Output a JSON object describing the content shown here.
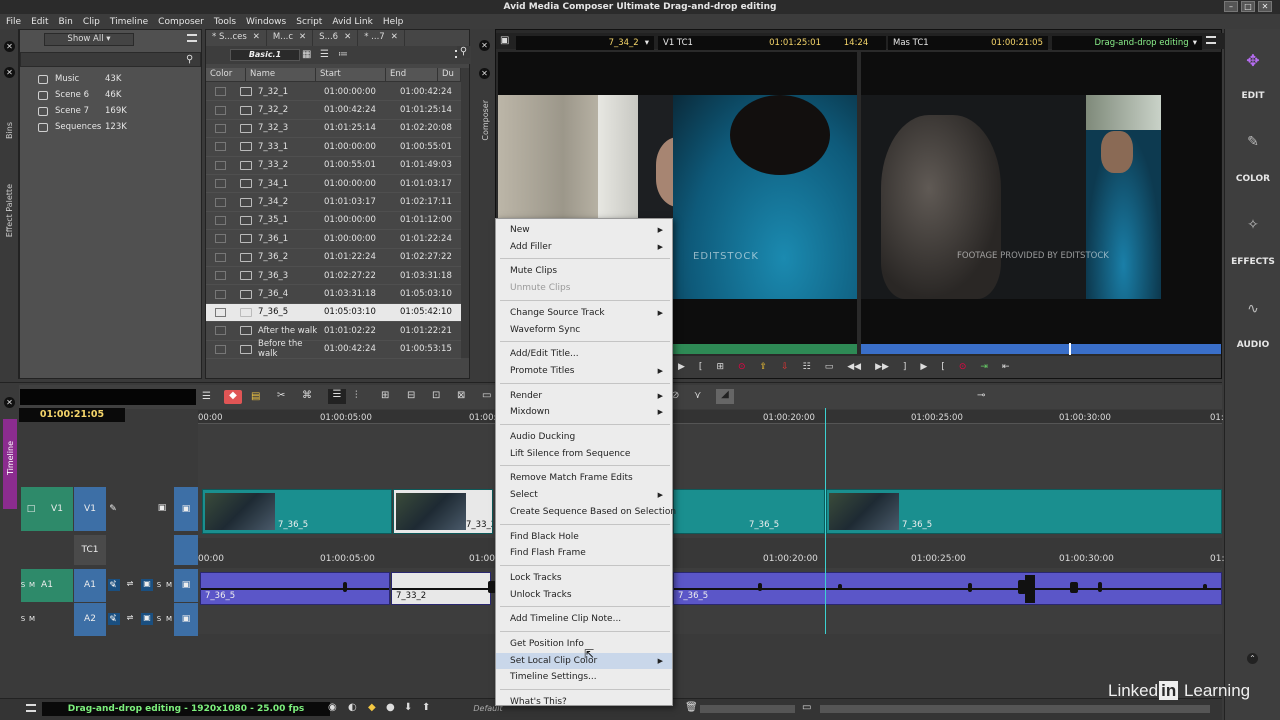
{
  "window": {
    "title": "Avid Media Composer Ultimate Drag-and-drop editing"
  },
  "menu": [
    "File",
    "Edit",
    "Bin",
    "Clip",
    "Timeline",
    "Composer",
    "Tools",
    "Windows",
    "Script",
    "Avid Link",
    "Help"
  ],
  "side_tabs": {
    "bins": "Bins",
    "effect_palette": "Effect Palette",
    "composer": "Composer",
    "timeline": "Timeline"
  },
  "bins": {
    "filter": "Show All",
    "items": [
      {
        "name": "Music",
        "size": "43K"
      },
      {
        "name": "Scene 6",
        "size": "46K"
      },
      {
        "name": "Scene 7",
        "size": "169K"
      },
      {
        "name": "Sequences",
        "size": "123K"
      }
    ]
  },
  "bin_content": {
    "tabs": [
      "* S...ces",
      "M...c",
      "S...6",
      "* ...7"
    ],
    "view": "Basic.1",
    "columns": [
      "Color",
      "Name",
      "Start",
      "End",
      "Du"
    ],
    "rows": [
      {
        "name": "7_32_1",
        "start": "01:00:00:00",
        "end": "01:00:42:24",
        "type": "clip"
      },
      {
        "name": "7_32_2",
        "start": "01:00:42:24",
        "end": "01:01:25:14",
        "type": "clip"
      },
      {
        "name": "7_32_3",
        "start": "01:01:25:14",
        "end": "01:02:20:08",
        "type": "clip"
      },
      {
        "name": "7_33_1",
        "start": "01:00:00:00",
        "end": "01:00:55:01",
        "type": "clip"
      },
      {
        "name": "7_33_2",
        "start": "01:00:55:01",
        "end": "01:01:49:03",
        "type": "clip"
      },
      {
        "name": "7_34_1",
        "start": "01:00:00:00",
        "end": "01:01:03:17",
        "type": "clip"
      },
      {
        "name": "7_34_2",
        "start": "01:01:03:17",
        "end": "01:02:17:11",
        "type": "clip"
      },
      {
        "name": "7_35_1",
        "start": "01:00:00:00",
        "end": "01:01:12:00",
        "type": "clip"
      },
      {
        "name": "7_36_1",
        "start": "01:00:00:00",
        "end": "01:01:22:24",
        "type": "clip"
      },
      {
        "name": "7_36_2",
        "start": "01:01:22:24",
        "end": "01:02:27:22",
        "type": "clip"
      },
      {
        "name": "7_36_3",
        "start": "01:02:27:22",
        "end": "01:03:31:18",
        "type": "clip"
      },
      {
        "name": "7_36_4",
        "start": "01:03:31:18",
        "end": "01:05:03:10",
        "type": "clip"
      },
      {
        "name": "7_36_5",
        "start": "01:05:03:10",
        "end": "01:05:42:10",
        "type": "clip",
        "selected": true
      },
      {
        "name": "After the walk",
        "start": "01:01:02:22",
        "end": "01:01:22:21",
        "type": "subclip"
      },
      {
        "name": "Before the walk",
        "start": "01:00:42:24",
        "end": "01:00:53:15",
        "type": "subclip"
      }
    ]
  },
  "composer": {
    "source_clip": "7_34_2",
    "source_tc_label": "V1 TC1",
    "source_tc": "01:01:25:01",
    "duration": "14:24",
    "master_tc_label": "Mas TC1",
    "master_tc": "01:00:21:05",
    "sequence": "Drag-and-drop editing",
    "overlay_left": "EDITSTOCK",
    "overlay_right": "FOOTAGE PROVIDED BY EDITSTOCK"
  },
  "right_panel": [
    "EDIT",
    "COLOR",
    "EFFECTS",
    "AUDIO"
  ],
  "timeline": {
    "timecode": "01:00:21:05",
    "ruler": [
      "00:00",
      "01:00:05:00",
      "01:00:",
      "01:00:20:00",
      "01:00:25:00",
      "01:00:30:00",
      "01:"
    ],
    "tracks": [
      "V1",
      "TC1",
      "A1",
      "A2"
    ],
    "v1_clips": [
      "7_36_5",
      "7_33_2",
      "7_36_5",
      "7_36_5"
    ],
    "tc_ticks": [
      "00:00",
      "01:00:05:00",
      "01:00:",
      "01:00:20:00",
      "01:00:25:00",
      "01:00:30:00",
      "01:"
    ],
    "a1_clips": [
      "7_36_5",
      "7_33_2",
      "7_36_5"
    ],
    "solo": "S",
    "mute": "M"
  },
  "status": {
    "sequence_info": "Drag-and-drop editing - 1920x1080 - 25.00 fps",
    "workspace": "Default"
  },
  "context_menu": [
    {
      "label": "New",
      "sub": true
    },
    {
      "label": "Add Filler",
      "sub": true
    },
    {
      "sep": true
    },
    {
      "label": "Mute Clips"
    },
    {
      "label": "Unmute Clips",
      "disabled": true
    },
    {
      "sep": true
    },
    {
      "label": "Change Source Track",
      "sub": true
    },
    {
      "label": "Waveform Sync"
    },
    {
      "sep": true
    },
    {
      "label": "Add/Edit Title..."
    },
    {
      "label": "Promote Titles",
      "sub": true
    },
    {
      "sep": true
    },
    {
      "label": "Render",
      "sub": true
    },
    {
      "label": "Mixdown",
      "sub": true
    },
    {
      "sep": true
    },
    {
      "label": "Audio Ducking"
    },
    {
      "label": "Lift Silence from Sequence"
    },
    {
      "sep": true
    },
    {
      "label": "Remove Match Frame Edits"
    },
    {
      "label": "Select",
      "sub": true
    },
    {
      "label": "Create Sequence Based on Selection"
    },
    {
      "sep": true
    },
    {
      "label": "Find Black Hole"
    },
    {
      "label": "Find Flash Frame"
    },
    {
      "sep": true
    },
    {
      "label": "Lock Tracks"
    },
    {
      "label": "Unlock Tracks"
    },
    {
      "sep": true
    },
    {
      "label": "Add Timeline Clip Note..."
    },
    {
      "sep": true
    },
    {
      "label": "Get Position Info"
    },
    {
      "label": "Set Local Clip Color",
      "sub": true,
      "highlighted": true
    },
    {
      "label": "Timeline Settings..."
    },
    {
      "sep": true
    },
    {
      "label": "What's This?"
    }
  ],
  "watermark": "Linked in Learning",
  "colors": {
    "v1": "#1a8f8f",
    "a1": "#5b56c8",
    "track_hdr_v": "#2e8a6a",
    "track_hdr_a": "#3d6fa6",
    "timecode": "#f5d56a"
  }
}
